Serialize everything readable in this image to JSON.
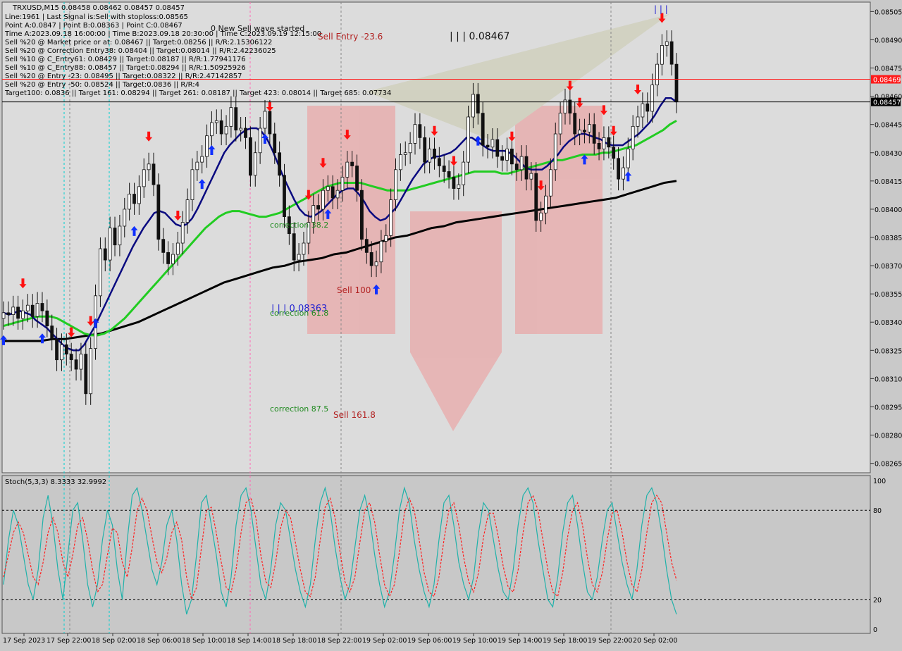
{
  "chart_data": [
    {
      "type": "candlestick",
      "symbol_header": "TRXUSD,M15  0.08458 0.08462 0.08457 0.08457",
      "info_lines": [
        "Line:1961 | Last Signal is:Sell with stoploss:0.08565",
        "Point A:0.0847 | Point B:0.08363 | Point C:0.08467",
        "Time A:2023.09.18 16:00:00 | Time B:2023.09.18 20:30:00 | Time C:2023.09.19 12:15:00",
        "Sell %20 @ Market price or at: 0.08467 || Target:0.08256 || R/R:2.15306122",
        "Sell %20 @ Correction Entry38: 0.08404 || Target:0.08014 || R/R:2.42236025",
        "Sell %10 @ C_Entry61: 0.08429 || Target:0.08187 || R/R:1.77941176",
        "Sell %10 @ C_Entry88: 0.08457 || Target:0.08294 || R/R:1.50925926",
        "Sell %20 @ Entry -23: 0.08495 || Target:0.08322 || R/R:2.47142857",
        "Sell %20 @ Entry -50: 0.08524 || Target:0.0836 || R/R:4",
        "Target100: 0.0836 || Target 161: 0.08294 || Target 261: 0.08187 || Target 423: 0.08014 || Target 685: 0.07734"
      ],
      "ylim": [
        0.0826,
        0.0851
      ],
      "y_ticks": [
        "0.08505",
        "0.08490",
        "0.08475",
        "0.08460",
        "0.08445",
        "0.08430",
        "0.08415",
        "0.08400",
        "0.08385",
        "0.08370",
        "0.08355",
        "0.08340",
        "0.08325",
        "0.08310",
        "0.08295",
        "0.08280",
        "0.08265"
      ],
      "x_ticks": [
        "17 Sep 2023",
        "17 Sep 22:00",
        "18 Sep 02:00",
        "18 Sep 06:00",
        "18 Sep 10:00",
        "18 Sep 14:00",
        "18 Sep 18:00",
        "18 Sep 22:00",
        "19 Sep 02:00",
        "19 Sep 06:00",
        "19 Sep 10:00",
        "19 Sep 14:00",
        "19 Sep 18:00",
        "19 Sep 22:00",
        "20 Sep 02:00"
      ],
      "price_labels": [
        {
          "value": 0.08469,
          "text": "0.08469",
          "color": "#ff1a1a"
        },
        {
          "value": 0.08457,
          "text": "0.08457",
          "color": "#000000"
        }
      ],
      "annotations": {
        "new_sell": "0 New Sell wave started",
        "sell_entry": "Sell Entry -23.6",
        "point_c": "| | | 0.08467",
        "point_b": "| | | 0.08363",
        "top_marks": "| | |",
        "correction_38": "correction 38.2",
        "correction_61": "correction 61.8",
        "correction_87": "correction 87.5",
        "sell_100": "Sell 100",
        "sell_161": "Sell 161.8"
      },
      "close": [
        0.08345,
        0.08344,
        0.08348,
        0.08342,
        0.08346,
        0.08349,
        0.08343,
        0.0835,
        0.08346,
        0.08338,
        0.08331,
        0.0832,
        0.08328,
        0.08323,
        0.0832,
        0.08315,
        0.08323,
        0.08302,
        0.08326,
        0.08354,
        0.08379,
        0.08373,
        0.0839,
        0.08381,
        0.08391,
        0.084,
        0.08408,
        0.08403,
        0.08412,
        0.08421,
        0.08424,
        0.08413,
        0.08384,
        0.08377,
        0.08371,
        0.08376,
        0.08382,
        0.08393,
        0.08405,
        0.08421,
        0.08425,
        0.08428,
        0.08439,
        0.08446,
        0.08447,
        0.0844,
        0.08444,
        0.08454,
        0.08442,
        0.08443,
        0.08438,
        0.08418,
        0.0843,
        0.08443,
        0.08452,
        0.0844,
        0.0843,
        0.08418,
        0.08396,
        0.08387,
        0.08373,
        0.08376,
        0.08382,
        0.08393,
        0.08402,
        0.084,
        0.0841,
        0.08412,
        0.08406,
        0.0841,
        0.08417,
        0.08425,
        0.08423,
        0.0841,
        0.08384,
        0.08377,
        0.0837,
        0.08372,
        0.08383,
        0.08386,
        0.08405,
        0.08421,
        0.08429,
        0.0843,
        0.08435,
        0.08445,
        0.08438,
        0.08425,
        0.08432,
        0.08427,
        0.08423,
        0.0842,
        0.08417,
        0.08411,
        0.08413,
        0.08425,
        0.08449,
        0.08461,
        0.08451,
        0.08434,
        0.08433,
        0.08437,
        0.08428,
        0.08426,
        0.08432,
        0.08424,
        0.08421,
        0.08428,
        0.08416,
        0.08419,
        0.08394,
        0.08398,
        0.08407,
        0.08421,
        0.0844,
        0.08451,
        0.08458,
        0.08451,
        0.0844,
        0.08442,
        0.08441,
        0.08445,
        0.08435,
        0.08432,
        0.08438,
        0.08433,
        0.08427,
        0.08416,
        0.08422,
        0.08432,
        0.08444,
        0.08449,
        0.08456,
        0.08452,
        0.08466,
        0.08477,
        0.08487,
        0.08489,
        0.08477,
        0.08457
      ],
      "indicators": {
        "ema_fast": [
          0.08345,
          0.08344,
          0.08345,
          0.08346,
          0.08345,
          0.08344,
          0.08341,
          0.08339,
          0.08337,
          0.08334,
          0.08331,
          0.08328,
          0.08326,
          0.08325,
          0.08325,
          0.08328,
          0.08333,
          0.08338,
          0.08344,
          0.0835,
          0.08356,
          0.08362,
          0.08368,
          0.08374,
          0.0838,
          0.08385,
          0.0839,
          0.08394,
          0.08398,
          0.08399,
          0.08398,
          0.08395,
          0.08392,
          0.08391,
          0.08392,
          0.08395,
          0.084,
          0.08406,
          0.08412,
          0.08418,
          0.08424,
          0.0843,
          0.08434,
          0.08437,
          0.0844,
          0.08442,
          0.08443,
          0.08443,
          0.08441,
          0.08437,
          0.08431,
          0.08424,
          0.08417,
          0.08411,
          0.08405,
          0.084,
          0.08397,
          0.08396,
          0.08397,
          0.08399,
          0.08402,
          0.08405,
          0.08408,
          0.0841,
          0.08411,
          0.08411,
          0.08408,
          0.08404,
          0.08399,
          0.08396,
          0.08394,
          0.08395,
          0.08398,
          0.08401,
          0.08406,
          0.08411,
          0.08416,
          0.0842,
          0.08424,
          0.08426,
          0.08428,
          0.08428,
          0.08429,
          0.0843,
          0.08432,
          0.08435,
          0.08438,
          0.08438,
          0.08436,
          0.08434,
          0.08432,
          0.08431,
          0.08431,
          0.08431,
          0.0843,
          0.08428,
          0.08425,
          0.08422,
          0.08421,
          0.08421,
          0.08421,
          0.08423,
          0.08426,
          0.08429,
          0.08433,
          0.08436,
          0.08438,
          0.0844,
          0.0844,
          0.08439,
          0.08438,
          0.08437,
          0.08435,
          0.08434,
          0.08434,
          0.08434,
          0.08436,
          0.08438,
          0.0844,
          0.08443,
          0.08446,
          0.0845,
          0.08455,
          0.08459,
          0.08459,
          0.08457
        ],
        "ema_mid": [
          0.08338,
          0.08339,
          0.0834,
          0.08341,
          0.08342,
          0.08343,
          0.08343,
          0.08343,
          0.08342,
          0.0834,
          0.08338,
          0.08336,
          0.08334,
          0.08333,
          0.08333,
          0.08334,
          0.08336,
          0.08339,
          0.08342,
          0.08346,
          0.0835,
          0.08354,
          0.08358,
          0.08362,
          0.08366,
          0.0837,
          0.08374,
          0.08378,
          0.08382,
          0.08386,
          0.0839,
          0.08393,
          0.08396,
          0.08398,
          0.08399,
          0.08399,
          0.08398,
          0.08397,
          0.08396,
          0.08396,
          0.08397,
          0.08398,
          0.084,
          0.08402,
          0.08404,
          0.08406,
          0.08408,
          0.0841,
          0.08412,
          0.08413,
          0.08414,
          0.08414,
          0.08414,
          0.08414,
          0.08413,
          0.08412,
          0.08411,
          0.0841,
          0.0841,
          0.0841,
          0.0841,
          0.08411,
          0.08412,
          0.08413,
          0.08414,
          0.08415,
          0.08416,
          0.08417,
          0.08418,
          0.08419,
          0.0842,
          0.0842,
          0.0842,
          0.0842,
          0.08419,
          0.08419,
          0.0842,
          0.08421,
          0.08422,
          0.08423,
          0.08424,
          0.08425,
          0.08426,
          0.08426,
          0.08427,
          0.08428,
          0.08429,
          0.08429,
          0.08429,
          0.0843,
          0.0843,
          0.08431,
          0.08432,
          0.08433,
          0.08434,
          0.08436,
          0.08438,
          0.0844,
          0.08442,
          0.08445,
          0.08447
        ],
        "ema_slow": [
          0.0833,
          0.0833,
          0.0833,
          0.0833,
          0.08331,
          0.08331,
          0.08332,
          0.08333,
          0.08334,
          0.08336,
          0.08338,
          0.0834,
          0.08343,
          0.08346,
          0.08349,
          0.08352,
          0.08355,
          0.08358,
          0.08361,
          0.08363,
          0.08365,
          0.08367,
          0.08369,
          0.0837,
          0.08372,
          0.08373,
          0.08374,
          0.08376,
          0.08377,
          0.08379,
          0.08381,
          0.08383,
          0.08385,
          0.08386,
          0.08388,
          0.0839,
          0.08391,
          0.08393,
          0.08394,
          0.08395,
          0.08396,
          0.08397,
          0.08398,
          0.08399,
          0.084,
          0.08401,
          0.08402,
          0.08403,
          0.08404,
          0.08405,
          0.08406,
          0.08408,
          0.0841,
          0.08412,
          0.08414,
          0.08415
        ]
      },
      "signals": {
        "buy": [
          0,
          8,
          19,
          27,
          41,
          43,
          54,
          67,
          77,
          98,
          120,
          129,
          147,
          152
        ],
        "sell": [
          4,
          14,
          18,
          30,
          36,
          55,
          63,
          66,
          71,
          89,
          93,
          105,
          111,
          117,
          119,
          124,
          126,
          131,
          136,
          140
        ]
      }
    },
    {
      "type": "line",
      "title": "Stoch(5,3,3) 8.3333 32.9992",
      "ylim": [
        0,
        100
      ],
      "y_ticks": [
        "100",
        "80",
        "20",
        "0"
      ],
      "levels": [
        80,
        20
      ],
      "series": [
        {
          "name": "%K",
          "color": "#20b2aa",
          "values": [
            30,
            60,
            80,
            70,
            50,
            30,
            20,
            40,
            75,
            90,
            70,
            40,
            20,
            50,
            80,
            85,
            60,
            30,
            15,
            30,
            60,
            80,
            70,
            40,
            20,
            60,
            90,
            95,
            80,
            60,
            40,
            30,
            45,
            70,
            80,
            60,
            30,
            10,
            20,
            50,
            85,
            90,
            70,
            50,
            25,
            15,
            35,
            70,
            90,
            95,
            80,
            55,
            30,
            20,
            40,
            70,
            85,
            80,
            60,
            40,
            25,
            15,
            30,
            60,
            85,
            95,
            80,
            55,
            35,
            20,
            30,
            55,
            80,
            90,
            75,
            50,
            30,
            15,
            25,
            50,
            80,
            95,
            85,
            60,
            40,
            25,
            15,
            30,
            60,
            85,
            90,
            70,
            45,
            30,
            20,
            35,
            65,
            85,
            80,
            60,
            40,
            25,
            20,
            40,
            70,
            90,
            95,
            85,
            60,
            40,
            20,
            15,
            35,
            65,
            85,
            90,
            70,
            45,
            25,
            20,
            35,
            60,
            80,
            85,
            65,
            45,
            30,
            20,
            40,
            70,
            90,
            95,
            85,
            65,
            40,
            20,
            10
          ]
        },
        {
          "name": "%D",
          "color": "#ff2020",
          "values": [
            35,
            50,
            65,
            72,
            65,
            50,
            35,
            30,
            45,
            65,
            75,
            65,
            45,
            35,
            50,
            70,
            75,
            60,
            40,
            25,
            30,
            50,
            68,
            65,
            45,
            35,
            55,
            80,
            88,
            80,
            62,
            45,
            38,
            48,
            65,
            72,
            60,
            35,
            20,
            28,
            55,
            80,
            82,
            65,
            45,
            28,
            25,
            40,
            65,
            85,
            88,
            75,
            50,
            32,
            28,
            45,
            68,
            80,
            75,
            58,
            40,
            25,
            22,
            35,
            60,
            82,
            88,
            75,
            52,
            32,
            25,
            35,
            58,
            80,
            85,
            72,
            50,
            30,
            22,
            30,
            52,
            78,
            88,
            80,
            60,
            38,
            25,
            22,
            35,
            60,
            80,
            85,
            70,
            48,
            32,
            25,
            38,
            62,
            78,
            78,
            62,
            42,
            28,
            25,
            40,
            65,
            85,
            90,
            80,
            60,
            40,
            25,
            22,
            38,
            62,
            80,
            85,
            70,
            48,
            30,
            25,
            38,
            60,
            78,
            80,
            65,
            45,
            30,
            25,
            40,
            65,
            85,
            90,
            85,
            65,
            45,
            33
          ]
        }
      ]
    }
  ]
}
